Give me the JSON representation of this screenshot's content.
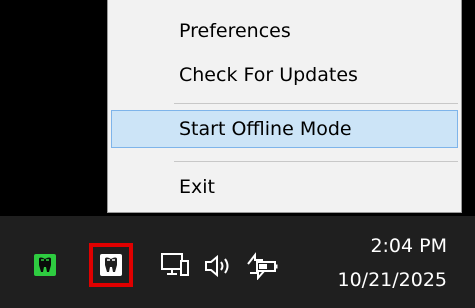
{
  "context_menu": {
    "items": [
      {
        "label": "Preferences"
      },
      {
        "label": "Check For Updates"
      },
      {
        "label": "Start Offline Mode",
        "highlighted": true
      },
      {
        "label": "Exit"
      }
    ]
  },
  "taskbar": {
    "tray_icons": [
      {
        "name": "app-tooth-icon",
        "color": "#2ecc40"
      },
      {
        "name": "app-tooth-icon",
        "color": "#ffffff",
        "selected": true
      },
      {
        "name": "network-monitor-icon"
      },
      {
        "name": "speaker-volume-icon"
      },
      {
        "name": "battery-power-icon"
      }
    ],
    "clock": {
      "time": "2:04 PM",
      "date": "10/21/2025"
    }
  },
  "colors": {
    "menu_background": "#f2f2f2",
    "menu_highlight": "#cce4f7",
    "menu_highlight_border": "#7eb4ea",
    "taskbar_background": "#1f1f1f",
    "selection_outline": "#e00000",
    "tooth_green": "#2ecc40"
  }
}
